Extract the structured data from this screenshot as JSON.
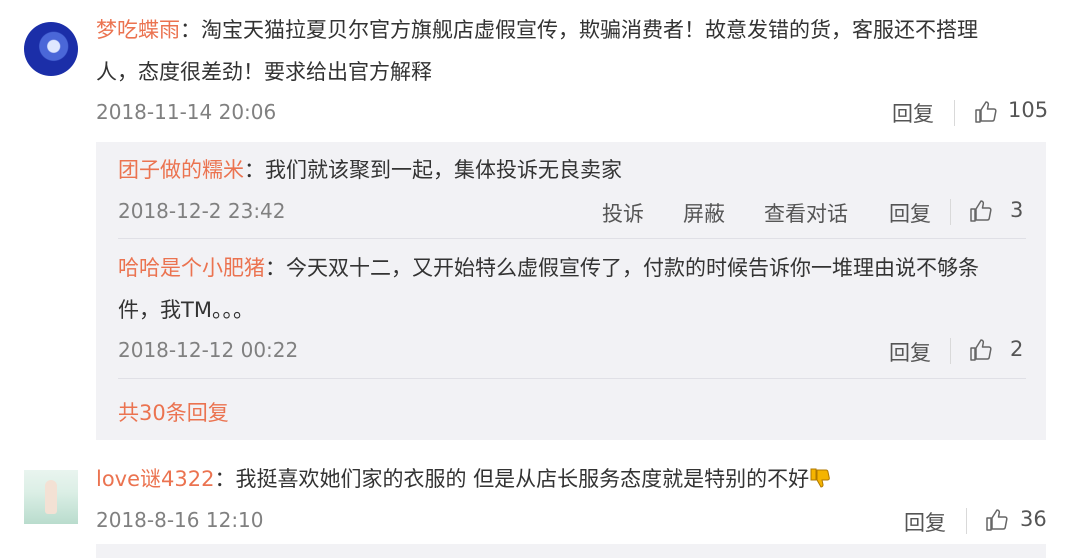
{
  "comments": [
    {
      "username": "梦吃蝶雨",
      "text_line1": "：淘宝天猫拉夏贝尔官方旗舰店虚假宣传，欺骗消费者！故意发错的货，客服还不搭理",
      "text_line2": "人，态度很差劲！要求给出官方解释",
      "timestamp": "2018-11-14 20:06",
      "reply_label": "回复",
      "likes": "105",
      "replies": [
        {
          "username": "团子做的糯米",
          "text": "：我们就该聚到一起，集体投诉无良卖家",
          "timestamp": "2018-12-2 23:42",
          "report_label": "投诉",
          "block_label": "屏蔽",
          "view_conversation_label": "查看对话",
          "reply_label": "回复",
          "likes": "3"
        },
        {
          "username": "哈哈是个小肥猪",
          "text_line1": "：今天双十二，又开始特么虚假宣传了，付款的时候告诉你一堆理由说不够条",
          "text_line2": "件，我TM。。。",
          "timestamp": "2018-12-12 00:22",
          "reply_label": "回复",
          "likes": "2"
        }
      ],
      "more_replies_label": "共30条回复"
    },
    {
      "username": "love谜4322",
      "text": "：我挺喜欢她们家的衣服的 但是从店长服务态度就是特别的不好",
      "emoji": "thumbs-down-emoji",
      "timestamp": "2018-8-16 12:10",
      "reply_label": "回复",
      "likes": "36"
    }
  ],
  "colors": {
    "username": "#eb7350",
    "reply_box_bg": "#f2f2f5",
    "timestamp": "#808080"
  }
}
